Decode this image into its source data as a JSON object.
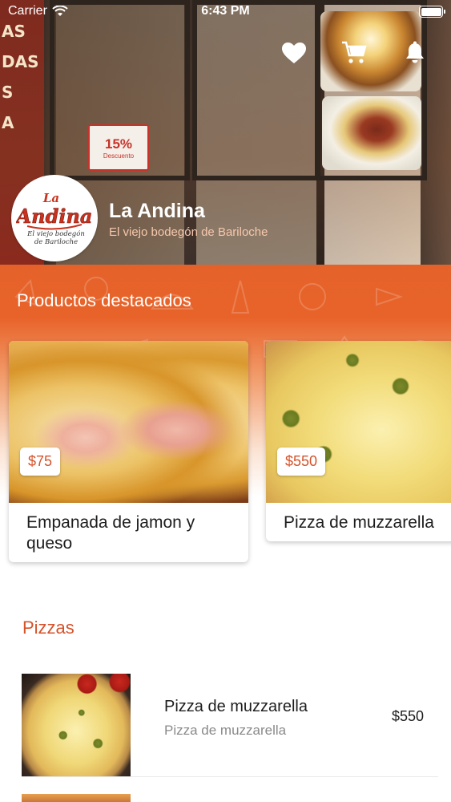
{
  "status_bar": {
    "carrier": "Carrier",
    "time": "6:43 PM"
  },
  "top_actions": [
    "heart-icon",
    "cart-icon",
    "bell-icon"
  ],
  "storefront_sign": {
    "percent": "15%",
    "caption": "Descuento"
  },
  "storefront_text": [
    "AS",
    "DAS",
    "S",
    "A"
  ],
  "brand": {
    "name": "La Andina",
    "tagline": "El viejo bodegón de Bariloche",
    "logo_text": {
      "line1": "La",
      "line2": "Andina",
      "line3": "El viejo bodegón",
      "line4": "de Bariloche"
    }
  },
  "featured": {
    "title": "Productos destacados",
    "items": [
      {
        "name": "Empanada de jamon y queso",
        "price": "$75"
      },
      {
        "name": "Pizza de muzzarella",
        "price": "$550"
      }
    ]
  },
  "pizzas": {
    "title": "Pizzas",
    "items": [
      {
        "name": "Pizza de muzzarella",
        "description": "Pizza de muzzarella",
        "price": "$550"
      }
    ]
  },
  "colors": {
    "accent": "#d5532b",
    "hero_orange": "#e2622a",
    "text": "#1d1d1d",
    "muted": "#8a8a8a"
  }
}
